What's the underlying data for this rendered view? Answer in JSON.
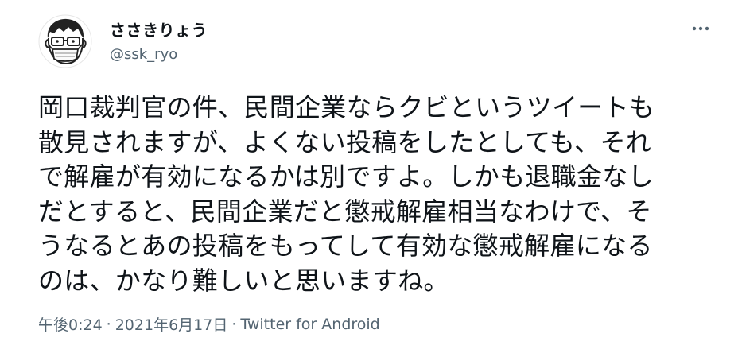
{
  "user": {
    "display_name": "ささきりょう",
    "handle": "@ssk_ryo",
    "avatar_icon": "cartoon-face-with-glasses-and-mask"
  },
  "tweet": {
    "text": "岡口裁判官の件、民間企業ならクビというツイートも\n散見されますが、よくない投稿をしたとしても、それ\nで解雇が有効になるかは別ですよ。しかも退職金なし\nだとすると、民間企業だと懲戒解雇相当なわけで、そ\nうなるとあの投稿をもってして有効な懲戒解雇になる\nのは、かなり難しいと思いますね。",
    "time": "午後0:24",
    "separator": "·",
    "date": "2021年6月17日",
    "source": "Twitter for Android"
  },
  "menu": {
    "more_icon": "more-horizontal-icon"
  },
  "colors": {
    "text": "#0f1419",
    "secondary": "#536471",
    "background": "#ffffff"
  }
}
